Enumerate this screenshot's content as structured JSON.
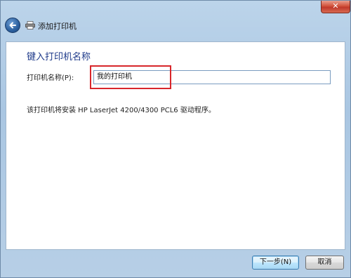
{
  "window": {
    "title": "添加打印机",
    "close_label": "✕"
  },
  "page": {
    "heading": "键入打印机名称",
    "name_label": "打印机名称(P):",
    "name_value": "我的打印机",
    "driver_note": "该打印机将安装 HP LaserJet 4200/4300 PCL6 驱动程序。"
  },
  "footer": {
    "next_label": "下一步(N)",
    "cancel_label": "取消"
  },
  "colors": {
    "accent_heading": "#1e3a8a",
    "highlight": "#d8262b"
  }
}
